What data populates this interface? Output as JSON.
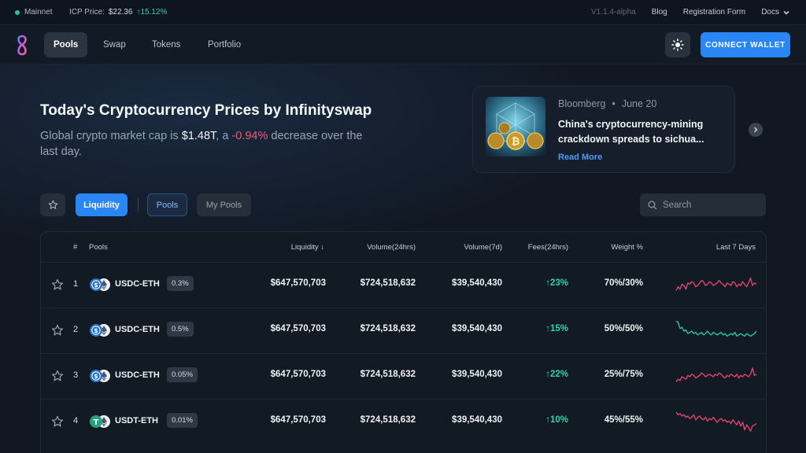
{
  "topbar": {
    "network": "Mainnet",
    "icp_label": "ICP Price:",
    "icp_price": "$22.36",
    "icp_change": "15.12%",
    "version": "V1.1.4-alpha",
    "links": [
      "Blog",
      "Registration Form"
    ],
    "docs": "Docs"
  },
  "nav": {
    "tabs": [
      {
        "label": "Pools",
        "active": true
      },
      {
        "label": "Swap",
        "active": false
      },
      {
        "label": "Tokens",
        "active": false
      },
      {
        "label": "Portfolio",
        "active": false
      }
    ],
    "connect_label": "CONNECT WALLET",
    "icons": {
      "logo": "infinityswap-logo",
      "theme": "sun-icon"
    }
  },
  "hero": {
    "title": "Today's Cryptocurrency Prices by Infinityswap",
    "sub_prefix": "Global crypto market cap is ",
    "market_cap": "$1.48T",
    "sub_mid": ", a ",
    "change": "-0.94%",
    "sub_suffix": " decrease over the last day."
  },
  "news": {
    "source": "Bloomberg",
    "separator": "•",
    "date": "June 20",
    "headline": "China's cryptocurrency-mining crackdown spreads to sichua...",
    "read_more": "Read More"
  },
  "filters": {
    "liquidity": "Liquidity",
    "pools": "Pools",
    "my_pools": "My Pools",
    "search_placeholder": "Search"
  },
  "table": {
    "headers": {
      "index": "#",
      "pools": "Pools",
      "liquidity": "Liquidity",
      "volume24": "Volume(24hrs)",
      "volume7": "Volume(7d)",
      "fees": "Fees(24hrs)",
      "weight": "Weight %",
      "last7": "Last 7 Days"
    },
    "rows": [
      {
        "index": "1",
        "pair": "USDC-ETH",
        "fee": "0.3%",
        "liquidity": "$647,570,703",
        "volume24": "$724,518,632",
        "volume7": "$39,540,430",
        "fees": "23%",
        "weight": "70%/30%",
        "spark_color": "#e0436b",
        "spark": [
          6,
          9,
          7,
          11,
          10,
          7,
          12,
          11,
          13,
          12,
          9,
          10,
          12,
          14,
          13,
          10,
          11,
          13,
          12,
          10,
          11,
          12,
          14,
          12,
          11,
          9,
          12,
          11,
          10,
          13,
          12,
          9,
          11,
          10,
          13,
          11,
          9,
          12,
          16,
          10,
          12,
          11
        ]
      },
      {
        "index": "2",
        "pair": "USDC-ETH",
        "fee": "0.5%",
        "liquidity": "$647,570,703",
        "volume24": "$724,518,632",
        "volume7": "$39,540,430",
        "fees": "15%",
        "weight": "50%/50%",
        "spark_color": "#1fc7a0",
        "spark": [
          18,
          17,
          12,
          13,
          10,
          11,
          8,
          9,
          10,
          8,
          9,
          7,
          8,
          9,
          7,
          8,
          10,
          8,
          7,
          9,
          8,
          7,
          8,
          9,
          7,
          8,
          6,
          7,
          8,
          7,
          9,
          6,
          7,
          8,
          7,
          6,
          8,
          7,
          6,
          7,
          8,
          10
        ]
      },
      {
        "index": "3",
        "pair": "USDC-ETH",
        "fee": "0.05%",
        "liquidity": "$647,570,703",
        "volume24": "$724,518,632",
        "volume7": "$39,540,430",
        "fees": "22%",
        "weight": "25%/75%",
        "spark_color": "#e0436b",
        "spark": [
          6,
          8,
          7,
          10,
          9,
          8,
          11,
          10,
          12,
          11,
          9,
          10,
          11,
          13,
          12,
          10,
          11,
          12,
          11,
          10,
          12,
          11,
          13,
          12,
          10,
          9,
          11,
          10,
          12,
          11,
          10,
          12,
          9,
          11,
          10,
          12,
          11,
          10,
          12,
          17,
          11,
          12
        ]
      },
      {
        "index": "4",
        "pair": "USDT-ETH",
        "fee": "0.01%",
        "liquidity": "$647,570,703",
        "volume24": "$724,518,632",
        "volume7": "$39,540,430",
        "fees": "10%",
        "weight": "45%/55%",
        "spark_color": "#e0436b",
        "spark": [
          18,
          16,
          17,
          15,
          16,
          14,
          15,
          13,
          14,
          16,
          12,
          14,
          15,
          13,
          12,
          14,
          11,
          13,
          12,
          14,
          12,
          10,
          12,
          13,
          11,
          12,
          10,
          11,
          9,
          12,
          10,
          8,
          11,
          7,
          10,
          4,
          8,
          6,
          3,
          7,
          8,
          9
        ]
      }
    ]
  }
}
